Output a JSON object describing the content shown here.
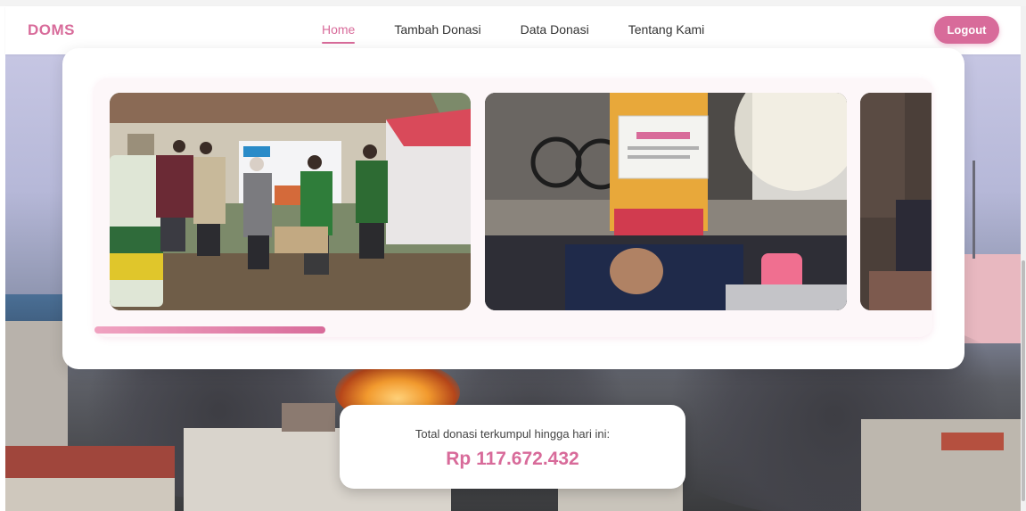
{
  "brand": {
    "name": "DOMS"
  },
  "nav": {
    "links": [
      {
        "label": "Home",
        "active": true
      },
      {
        "label": "Tambah Donasi",
        "active": false
      },
      {
        "label": "Data Donasi",
        "active": false
      },
      {
        "label": "Tentang Kami",
        "active": false
      }
    ],
    "logout_label": "Logout"
  },
  "gallery": {
    "slide_count_visible": 3,
    "progress_fraction": 0.275
  },
  "donation": {
    "label": "Total donasi terkumpul hingga hari ini:",
    "amount": "Rp 117.672.432"
  },
  "colors": {
    "accent": "#d86b9a",
    "card": "#ffffff",
    "text": "#333333"
  }
}
